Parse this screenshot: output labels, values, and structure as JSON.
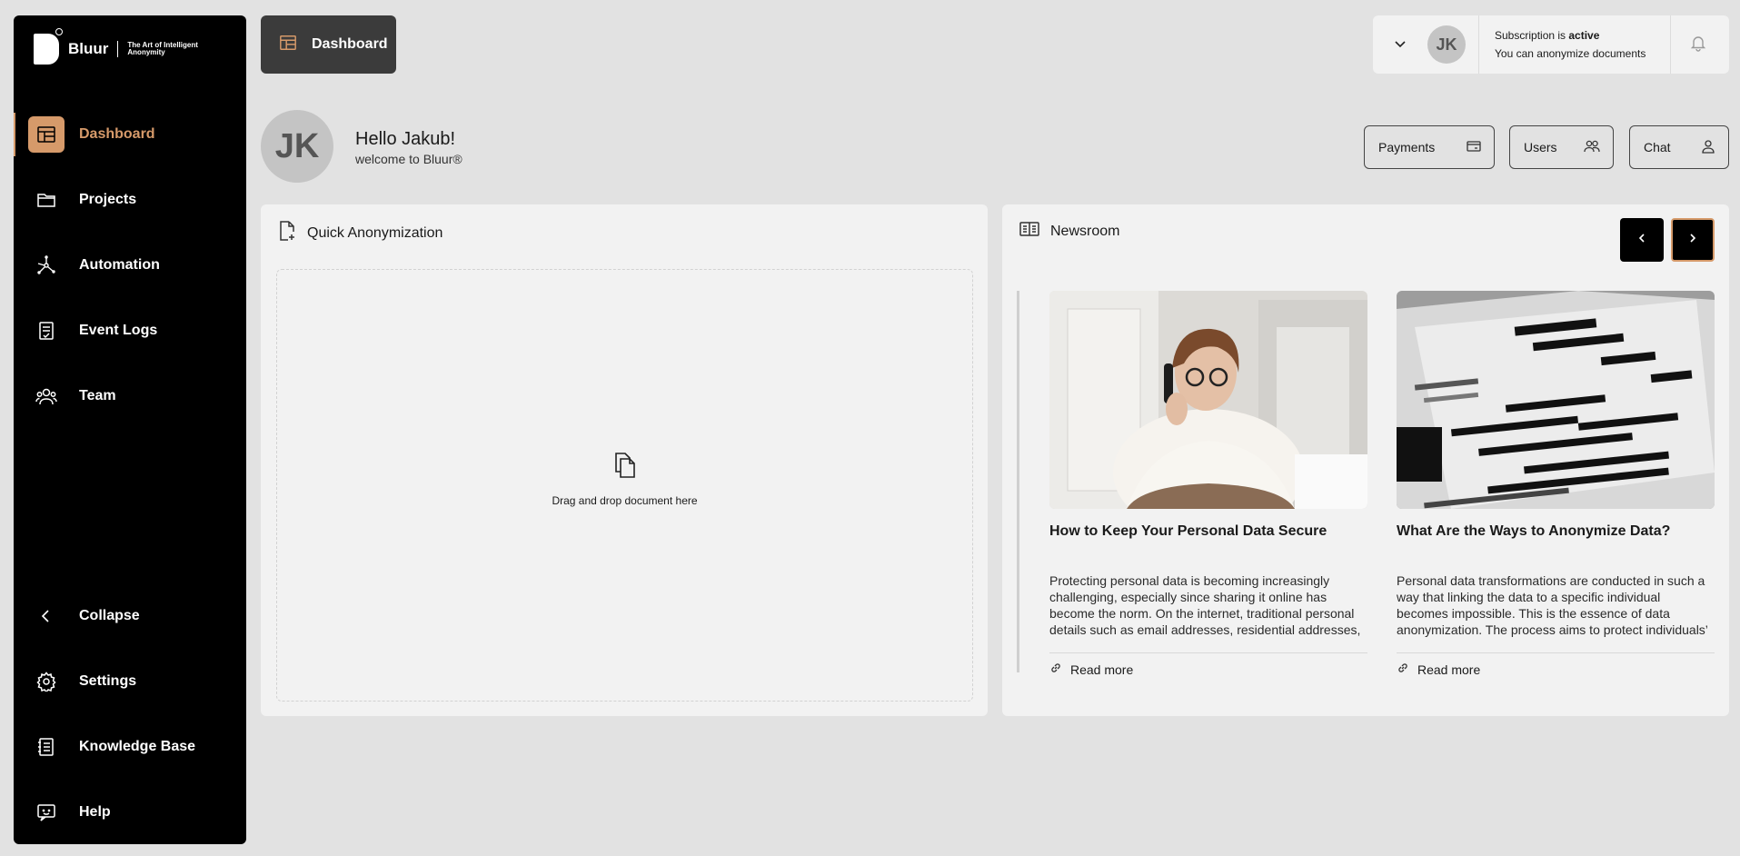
{
  "sidebar": {
    "logo": {
      "word": "Bluur",
      "tagline": "The Art of Intelligent Anonymity"
    },
    "items": [
      {
        "label": "Dashboard",
        "icon": "dashboard-icon",
        "active": true
      },
      {
        "label": "Projects",
        "icon": "folder-icon"
      },
      {
        "label": "Automation",
        "icon": "automation-icon"
      },
      {
        "label": "Event Logs",
        "icon": "event-log-icon"
      },
      {
        "label": "Team",
        "icon": "team-icon"
      }
    ],
    "bottom": [
      {
        "label": "Collapse",
        "icon": "chevron-left-icon"
      },
      {
        "label": "Settings",
        "icon": "gear-icon"
      },
      {
        "label": "Knowledge Base",
        "icon": "knowledge-base-icon"
      },
      {
        "label": "Help",
        "icon": "help-icon"
      }
    ],
    "accent": "#d69a6a"
  },
  "header": {
    "page_button": "Dashboard",
    "user_initials": "JK",
    "subscription_prefix": "Subscription is ",
    "subscription_status": "active",
    "subscription_note": "You can anonymize documents"
  },
  "greeting": {
    "initials": "JK",
    "hello": "Hello Jakub!",
    "welcome": "welcome to Bluur®"
  },
  "quick_actions": [
    {
      "label": "Payments",
      "icon": "credit-card-icon"
    },
    {
      "label": "Users",
      "icon": "users-icon"
    },
    {
      "label": "Chat",
      "icon": "chat-user-icon"
    }
  ],
  "quick_anonymization": {
    "title": "Quick Anonymization",
    "drop_text": "Drag and drop document here"
  },
  "newsroom": {
    "title": "Newsroom",
    "articles": [
      {
        "title": "How to Keep Your Personal Data Secure",
        "description": "Protecting personal data is becoming increasingly challenging, especially since sharing it online has become the norm. On the internet, traditional personal details such as email addresses, residential addresses, or phone numbers are commonly require...",
        "link": "Read more"
      },
      {
        "title": "What Are the Ways to Anonymize Data?",
        "description": "Personal data transformations are conducted in such a way that linking the data to a specific individual becomes impossible. This is the essence of data anonymization. The process aims to protect individuals’ privacy by eliminating the possibility of...",
        "link": "Read more"
      }
    ]
  }
}
